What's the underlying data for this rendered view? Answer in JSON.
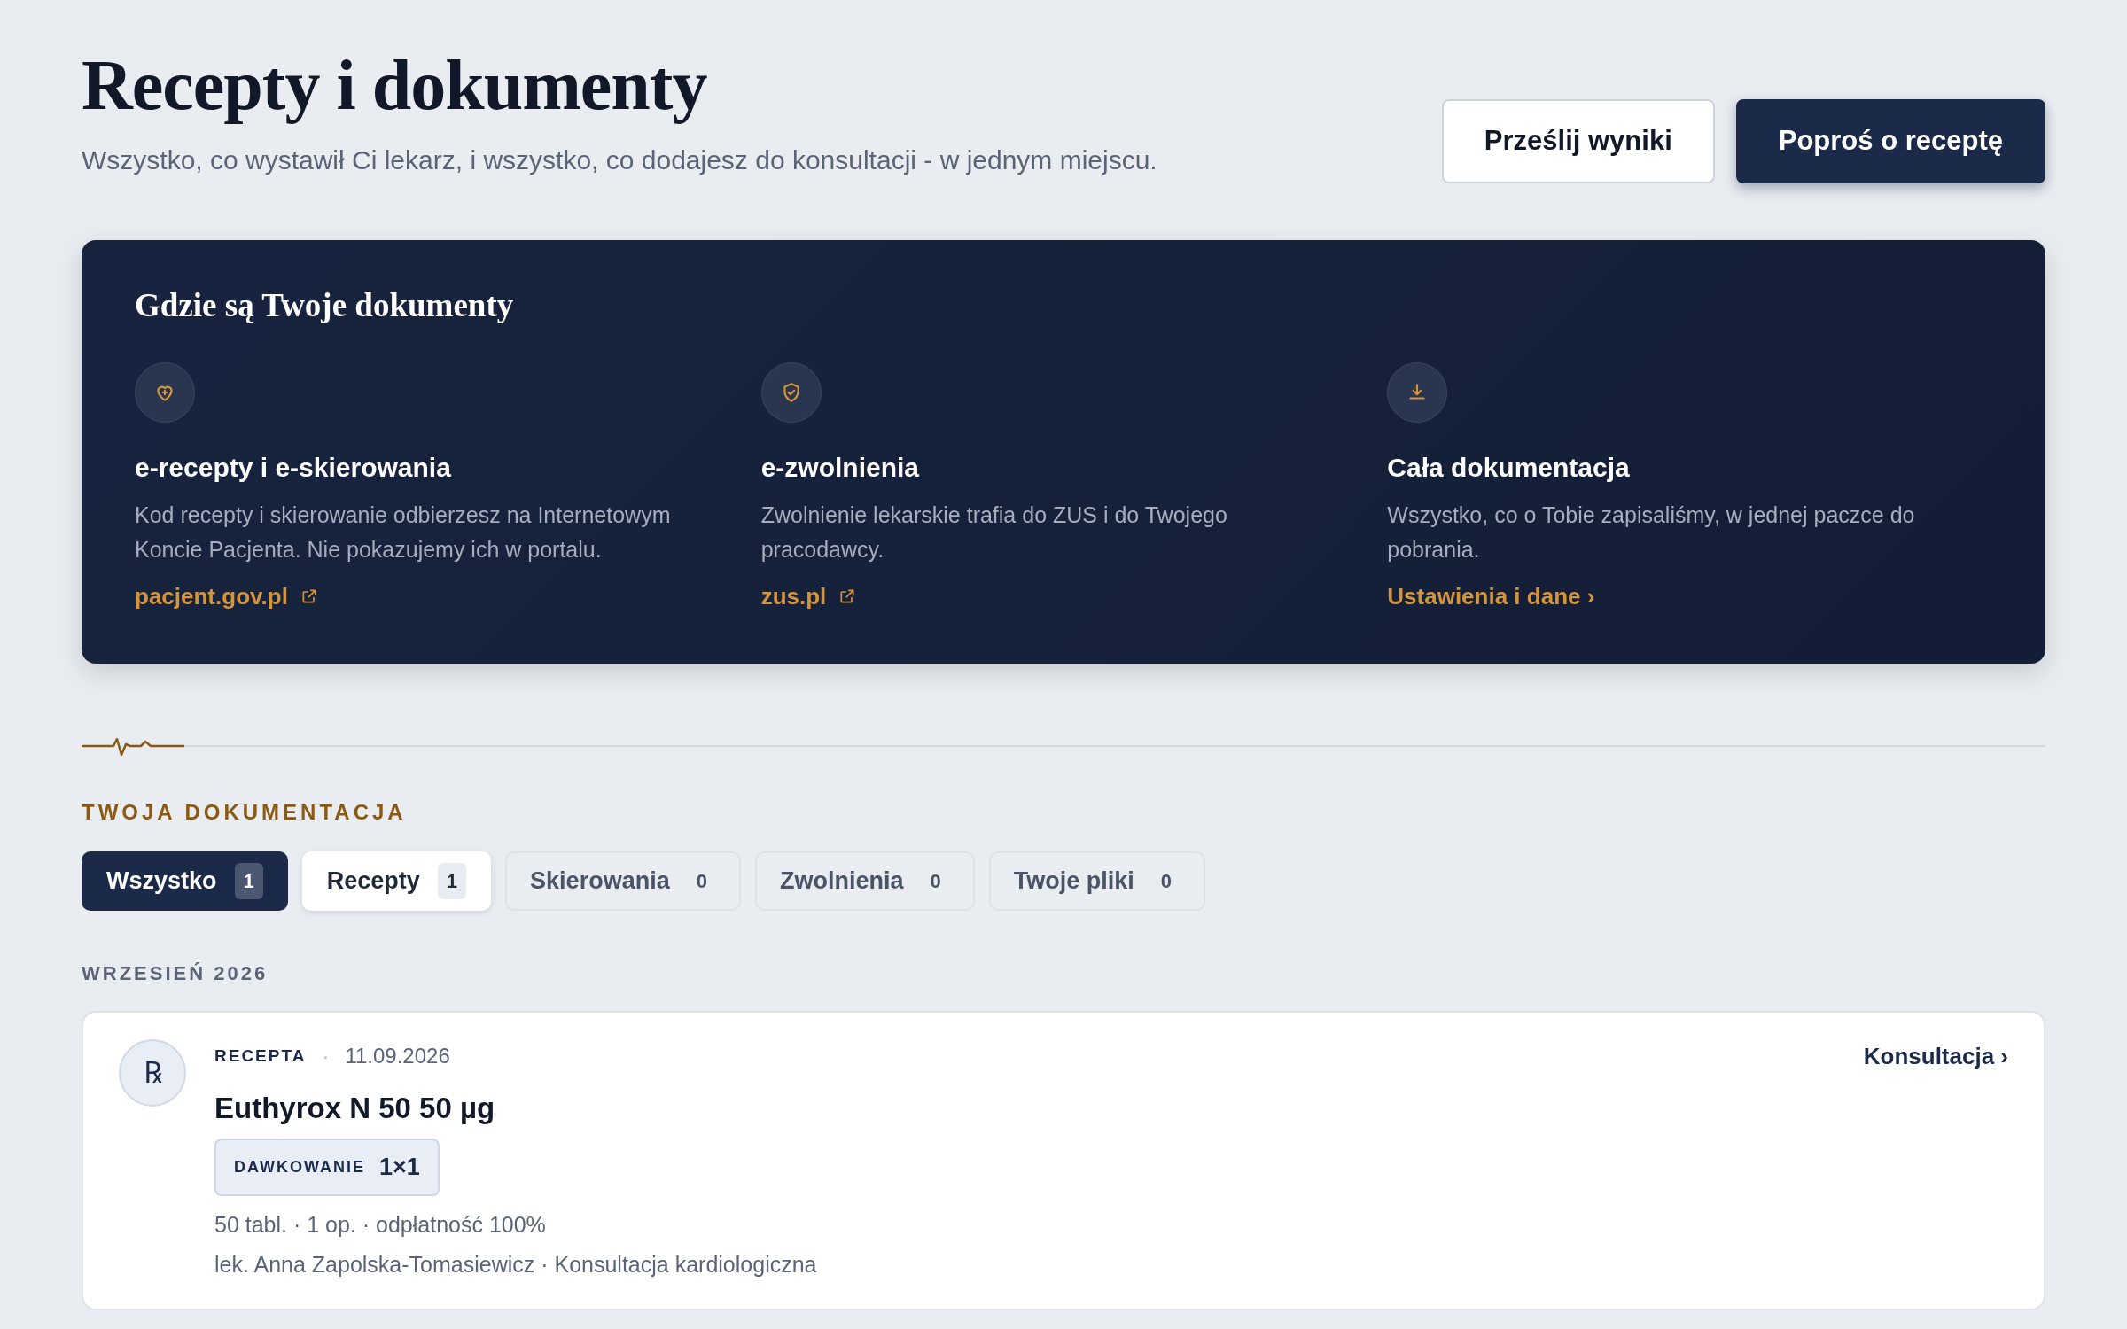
{
  "header": {
    "title": "Recepty i dokumenty",
    "subtitle": "Wszystko, co wystawił Ci lekarz, i wszystko, co dodajesz do konsultacji - w jednym miejscu.",
    "buttons": [
      {
        "label": "Prześlij wyniki",
        "kind": "secondary"
      },
      {
        "label": "Poproś o receptę",
        "kind": "primary"
      }
    ]
  },
  "info_panel": {
    "title": "Gdzie są Twoje dokumenty",
    "columns": [
      {
        "kind": "external",
        "title": "e-recepty i e-skierowania",
        "text": "Kod recepty i skierowanie odbierzesz na Internetowym Koncie Pacjenta. Nie pokazujemy ich w portalu.",
        "link": "pacjent.gov.pl"
      },
      {
        "kind": "external",
        "title": "e-zwolnienia",
        "text": "Zwolnienie lekarskie trafia do ZUS i do Twojego pracodawcy.",
        "link": "zus.pl"
      },
      {
        "kind": "internal",
        "title": "Cała dokumentacja",
        "text": "Wszystko, co o Tobie zapisaliśmy, w jednej paczce do pobrania.",
        "link": "Ustawienia i dane ›"
      }
    ]
  },
  "section_label": "TWOJA DOKUMENTACJA",
  "tabs": [
    {
      "label": "Wszystko",
      "count": "1",
      "selected": true
    },
    {
      "label": "Recepty",
      "count": "1",
      "selected": false,
      "highlighted": true
    },
    {
      "label": "Skierowania",
      "count": "0",
      "selected": false,
      "highlighted": false
    },
    {
      "label": "Zwolnienia",
      "count": "0",
      "selected": false,
      "highlighted": false
    },
    {
      "label": "Twoje pliki",
      "count": "0",
      "selected": false,
      "highlighted": false
    }
  ],
  "groups": [
    {
      "month": "WRZESIEŃ 2026",
      "documents": [
        {
          "icon_text": "℞",
          "type": "RECEPTA",
          "separator": "·",
          "date": "11.09.2026",
          "title": "Euthyrox N 50 50 µg",
          "dosage_label": "DAWKOWANIE",
          "dosage": "1×1",
          "details": "50 tabl. · 1 op. · odpłatność 100%",
          "doctor": "lek. Anna Zapolska-Tomasiewicz · Konsultacja kardiologiczna",
          "link": "Konsultacja ›"
        }
      ]
    }
  ]
}
